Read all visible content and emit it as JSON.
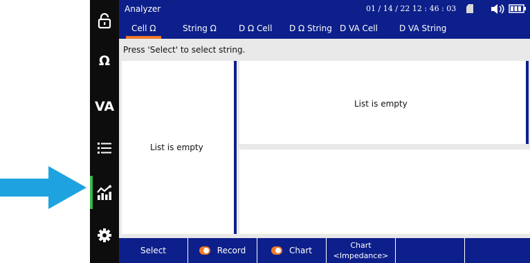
{
  "sidebar": {
    "items": [
      {
        "name": "lock-icon",
        "label": ""
      },
      {
        "name": "ohm-icon",
        "label": "Ω"
      },
      {
        "name": "va-icon",
        "label": "VA"
      },
      {
        "name": "list-icon",
        "label": ""
      },
      {
        "name": "chart-icon",
        "label": ""
      },
      {
        "name": "gear-icon",
        "label": ""
      }
    ],
    "active_index": 4
  },
  "header": {
    "title": "Analyzer",
    "datetime": "01 / 14 / 22  12 : 46 : 03"
  },
  "tabs": [
    {
      "label": "Cell Ω",
      "active": true
    },
    {
      "label": "String Ω",
      "active": false
    },
    {
      "label": "D Ω Cell",
      "active": false
    },
    {
      "label": "D Ω String",
      "active": false
    },
    {
      "label": "D VA Cell",
      "active": false
    },
    {
      "label": "D VA String",
      "active": false
    }
  ],
  "hint": "Press 'Select' to select string.",
  "panels": {
    "left_empty": "List is empty",
    "right_top_empty": "List is empty"
  },
  "toolbar": {
    "select_label": "Select",
    "record_label": "Record",
    "chart_label": "Chart",
    "chart_mode_line1": "Chart",
    "chart_mode_line2": "<Impedance>"
  },
  "colors": {
    "accent_blue": "#0d1f8a",
    "tab_underline": "#f07a28",
    "active_indicator": "#39b54a",
    "arrow": "#1ea3e0"
  }
}
